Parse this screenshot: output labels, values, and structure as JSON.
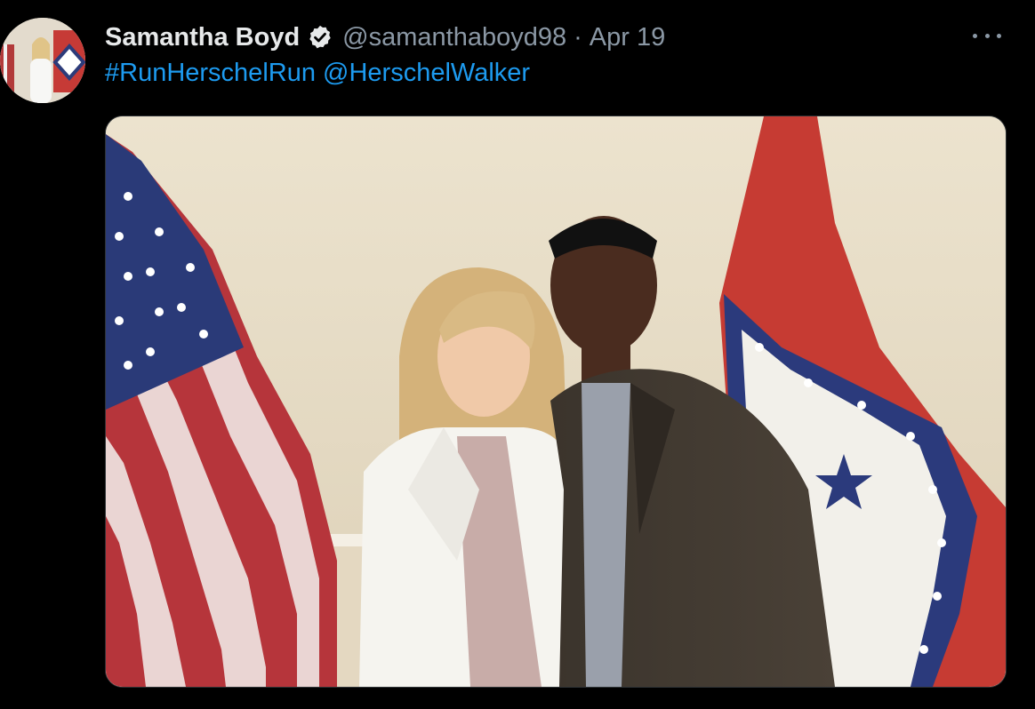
{
  "tweet": {
    "display_name": "Samantha Boyd",
    "verified": true,
    "handle": "@samanthaboyd98",
    "separator": "·",
    "date": "Apr 19",
    "text_parts": [
      "#RunHerschelRun",
      "@HerschelWalker"
    ]
  },
  "icons": {
    "verified": "verified-badge-icon",
    "more": "more-options-icon"
  },
  "colors": {
    "background": "#000000",
    "link": "#1d9bf0",
    "secondary_text": "#8b98a5",
    "primary_text": "#e7e9ea"
  }
}
